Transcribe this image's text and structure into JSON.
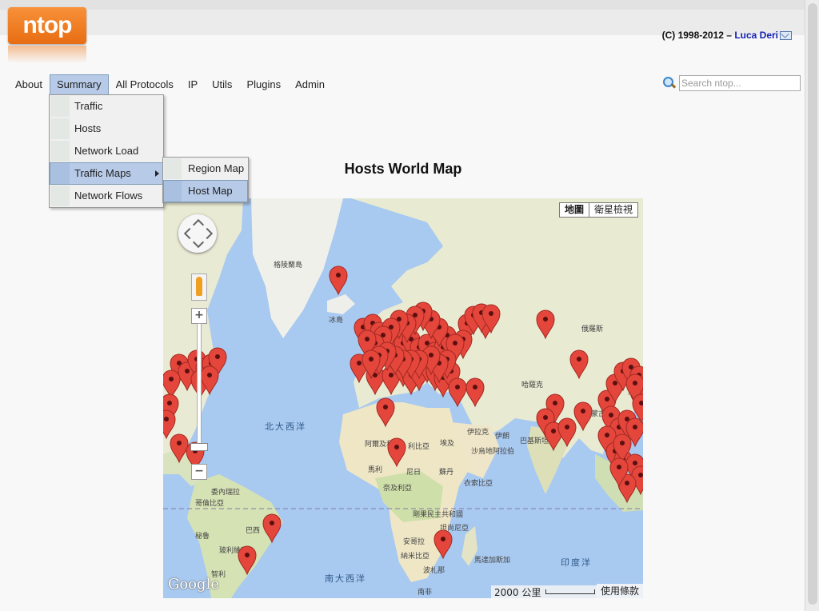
{
  "header": {
    "logo_text": "ntop",
    "copyright_prefix": "(C) 1998-2012 –",
    "copyright_author": "Luca Deri"
  },
  "menu": {
    "items": [
      "About",
      "Summary",
      "All Protocols",
      "IP",
      "Utils",
      "Plugins",
      "Admin"
    ],
    "active": "Summary"
  },
  "search": {
    "placeholder": "Search ntop..."
  },
  "summary_menu": {
    "items": [
      "Traffic",
      "Hosts",
      "Network Load",
      "Traffic Maps",
      "Network Flows"
    ],
    "highlighted": "Traffic Maps"
  },
  "traffic_maps_submenu": {
    "items": [
      "Region Map",
      "Host Map"
    ],
    "highlighted": "Host Map"
  },
  "page": {
    "title": "Hosts World Map"
  },
  "map": {
    "type_map": "地圖",
    "type_satellite": "衛星檢視",
    "scale": "2000 公里",
    "terms": "使用條款",
    "attribution": "Google",
    "labels": [
      "格陵蘭島",
      "冰島",
      "俄羅斯",
      "哈薩克",
      "蒙古",
      "北大西洋",
      "阿爾及利亞",
      "利比亞",
      "埃及",
      "伊拉克",
      "伊朗",
      "沙烏地阿拉伯",
      "巴基斯坦",
      "馬利",
      "尼日",
      "蘇丹",
      "奈及利亞",
      "衣索比亞",
      "委內瑞拉",
      "哥倫比亞",
      "秘魯",
      "巴西",
      "玻利維亞",
      "剛果民主共和國",
      "坦尚尼亞",
      "安哥拉",
      "納米比亞",
      "波札那",
      "馬達加斯加",
      "印度洋",
      "南大西洋",
      "智利",
      "南非",
      "蒙"
    ],
    "accent": "#e4463c"
  }
}
